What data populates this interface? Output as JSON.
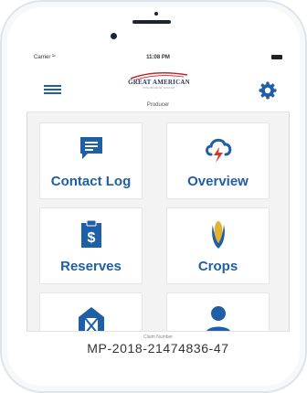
{
  "status_bar": {
    "carrier": "Carrier",
    "time": "11:08 PM"
  },
  "header": {
    "logo_text": "GREAT AMERICAN",
    "logo_subtext": "INSURANCE GROUP",
    "role": "Producer",
    "menu_icon": "hamburger-menu-icon",
    "settings_icon": "gear-icon"
  },
  "tiles": [
    {
      "label": "Contact Log",
      "icon": "chat-bubble-icon"
    },
    {
      "label": "Overview",
      "icon": "storm-cloud-icon"
    },
    {
      "label": "Reserves",
      "icon": "dollar-clipboard-icon"
    },
    {
      "label": "Crops",
      "icon": "corn-icon"
    },
    {
      "label": "",
      "icon": "barn-icon"
    },
    {
      "label": "",
      "icon": "person-icon"
    }
  ],
  "claim": {
    "caption": "Claim Number",
    "number": "MP-2018-21474836-47"
  },
  "colors": {
    "accent": "#1f5fa5",
    "alert": "#d9342b",
    "corn": "#e3b232"
  }
}
